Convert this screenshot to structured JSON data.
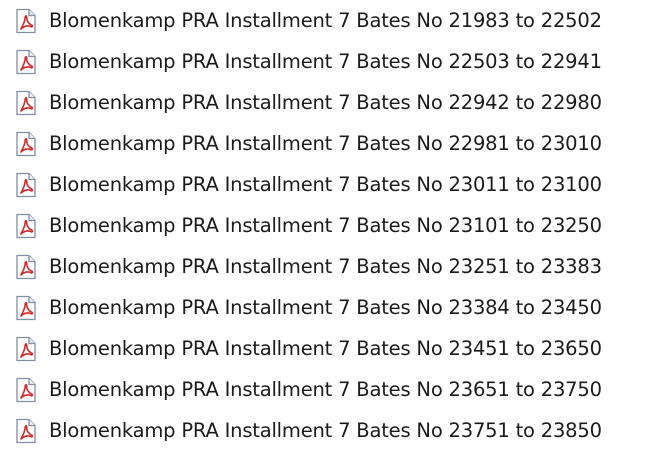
{
  "file_icon": "pdf-file-icon",
  "colors": {
    "icon_red": "#d22b2b",
    "icon_outline": "#7f8ea3",
    "text": "#1b1b1b"
  },
  "files": [
    {
      "name": "Blomenkamp PRA Installment 7 Bates No 21983 to 22502"
    },
    {
      "name": "Blomenkamp PRA Installment 7 Bates No 22503 to 22941"
    },
    {
      "name": "Blomenkamp PRA Installment 7 Bates No 22942 to 22980"
    },
    {
      "name": "Blomenkamp PRA Installment 7 Bates No 22981 to 23010"
    },
    {
      "name": "Blomenkamp PRA Installment 7 Bates No 23011 to 23100"
    },
    {
      "name": "Blomenkamp PRA Installment 7 Bates No 23101 to 23250"
    },
    {
      "name": "Blomenkamp PRA Installment 7 Bates No 23251 to 23383"
    },
    {
      "name": "Blomenkamp PRA Installment 7 Bates No 23384 to 23450"
    },
    {
      "name": "Blomenkamp PRA Installment 7 Bates No 23451 to 23650"
    },
    {
      "name": "Blomenkamp PRA Installment 7 Bates No 23651 to 23750"
    },
    {
      "name": "Blomenkamp PRA Installment 7 Bates No 23751 to 23850"
    }
  ]
}
